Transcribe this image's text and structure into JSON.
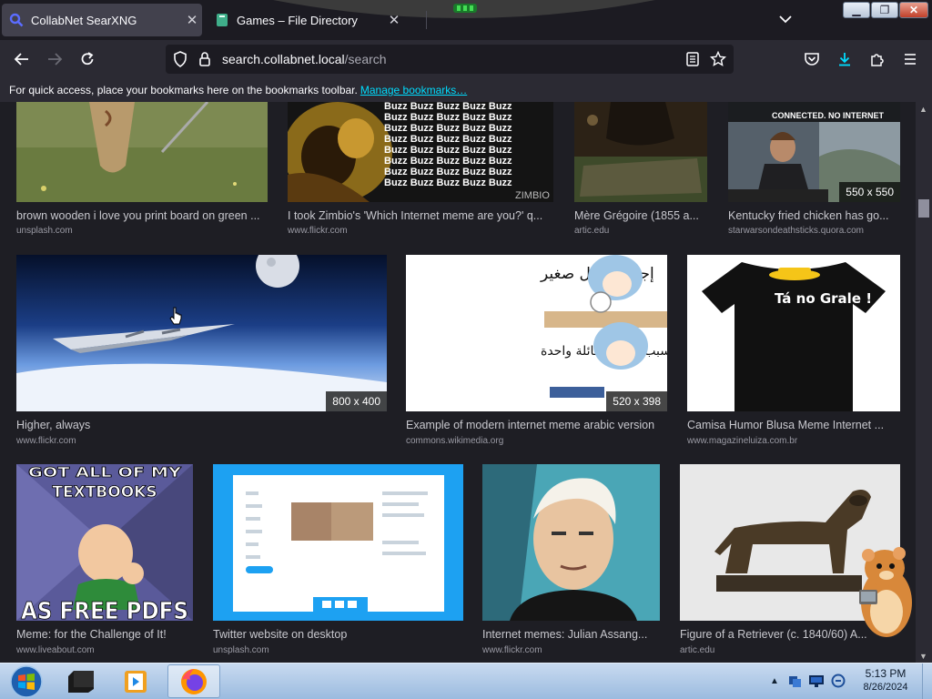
{
  "tabs": [
    {
      "label": "CollabNet SearXNG",
      "icon": "search-icon",
      "active": true
    },
    {
      "label": "Games – File Directory",
      "icon": "page-icon",
      "active": false
    }
  ],
  "address": {
    "scheme_host": "search.collabnet.local",
    "path": "/search"
  },
  "bookmarks_bar": {
    "message": "For quick access, place your bookmarks here on the bookmarks toolbar.",
    "link": "Manage bookmarks…"
  },
  "results": [
    {
      "title": "brown wooden i love you print board on green ...",
      "source": "unsplash.com",
      "resolution": ""
    },
    {
      "title": "I took Zimbio's 'Which Internet meme are you?' q...",
      "source": "www.flickr.com",
      "resolution": "",
      "overlay_text": "Buzz Buzz Buzz Buzz Buzz",
      "watermark": "ZIMBIO"
    },
    {
      "title": "Mère Grégoire (1855 a...",
      "source": "artic.edu",
      "resolution": ""
    },
    {
      "title": "Kentucky fried chicken has go...",
      "source": "starwarsondeathsticks.quora.com",
      "resolution": "550 x 550",
      "overlay_text": "CONNECTED. NO INTERNET"
    },
    {
      "title": "Higher, always",
      "source": "www.flickr.com",
      "resolution": "800 x 400"
    },
    {
      "title": "Example of modern internet meme arabic version",
      "source": "commons.wikimedia.org",
      "resolution": "520 x 398",
      "overlay_text_1": "إجراء تعديل صغير",
      "overlay_text_2": "كسر الصفحة بأكملها بسبب شرطة مائلة واحدة"
    },
    {
      "title": "Camisa Humor Blusa Meme Internet ...",
      "source": "www.magazineluiza.com.br",
      "resolution": "",
      "overlay_text": "Tá no Grale !"
    },
    {
      "title": "Meme: for the Challenge of It!",
      "source": "www.liveabout.com",
      "resolution": "",
      "overlay_top": "GOT ALL OF MY TEXTBOOKS",
      "overlay_bottom": "AS FREE PDFS"
    },
    {
      "title": "Twitter website on desktop",
      "source": "unsplash.com",
      "resolution": ""
    },
    {
      "title": "Internet memes: Julian Assang...",
      "source": "www.flickr.com",
      "resolution": ""
    },
    {
      "title": "Figure of a Retriever (c. 1840/60) A...",
      "source": "artic.edu",
      "resolution": ""
    }
  ],
  "taskbar": {
    "apps": [
      "start-orb",
      "terminal-app",
      "media-player-app",
      "firefox-app"
    ],
    "clock_time": "5:13 PM",
    "clock_date": "8/26/2024"
  },
  "colors": {
    "accent": "#00ddff",
    "tab_active": "#42414d",
    "toolbar": "#2b2a33",
    "page_bg": "#1e1e24"
  }
}
